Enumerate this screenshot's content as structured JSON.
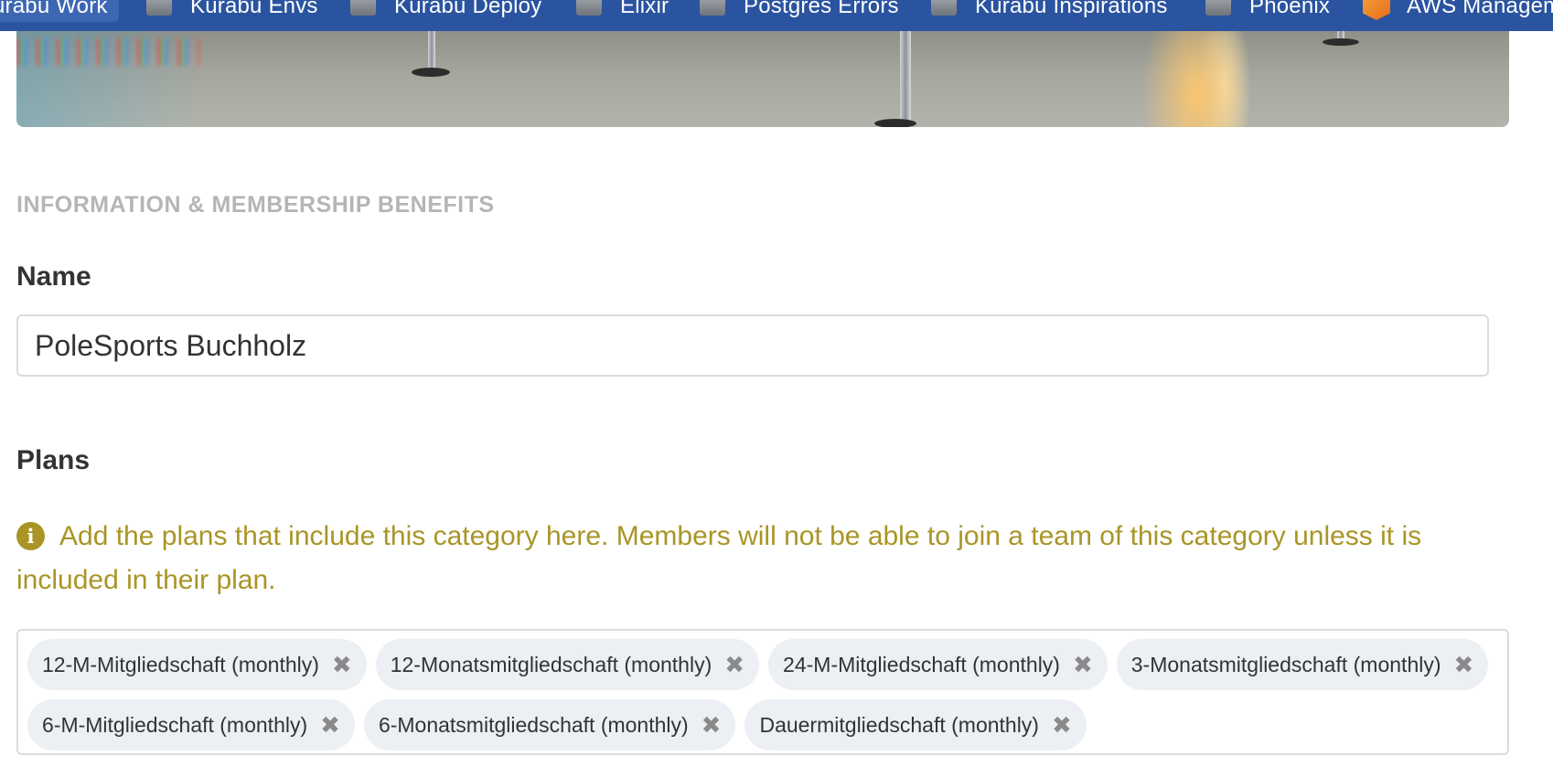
{
  "bookmarks": [
    {
      "label": "urabu Work",
      "icon": "folder-icon"
    },
    {
      "label": "Kurabu Envs",
      "icon": "folder-icon"
    },
    {
      "label": "Kurabu Deploy",
      "icon": "folder-icon"
    },
    {
      "label": "Elixir",
      "icon": "folder-icon"
    },
    {
      "label": "Postgres Errors",
      "icon": "folder-icon"
    },
    {
      "label": "Kurabu Inspirations",
      "icon": "folder-icon"
    },
    {
      "label": "Phoenix",
      "icon": "folder-icon"
    },
    {
      "label": "AWS Managem",
      "icon": "aws-icon"
    }
  ],
  "section": {
    "title": "INFORMATION & MEMBERSHIP BENEFITS"
  },
  "name_field": {
    "label": "Name",
    "value": "PoleSports Buchholz"
  },
  "plans": {
    "label": "Plans",
    "notice": "Add the plans that include this category here. Members will not be able to join a team of this category unless it is included in their plan.",
    "notice_icon": "info-icon",
    "remove_icon": "✖",
    "tags": [
      "12-M-Mitgliedschaft (monthly)",
      "12-Monatsmitgliedschaft (monthly)",
      "24-M-Mitgliedschaft (monthly)",
      "3-Monatsmitgliedschaft (monthly)",
      "6-M-Mitgliedschaft (monthly)",
      "6-Monatsmitgliedschaft (monthly)",
      "Dauermitgliedschaft (monthly)"
    ]
  },
  "colors": {
    "bookmark_bar": "#2b54a0",
    "notice": "#a99526",
    "section_title": "#b5b5b5",
    "tag_background": "#eceff3"
  }
}
